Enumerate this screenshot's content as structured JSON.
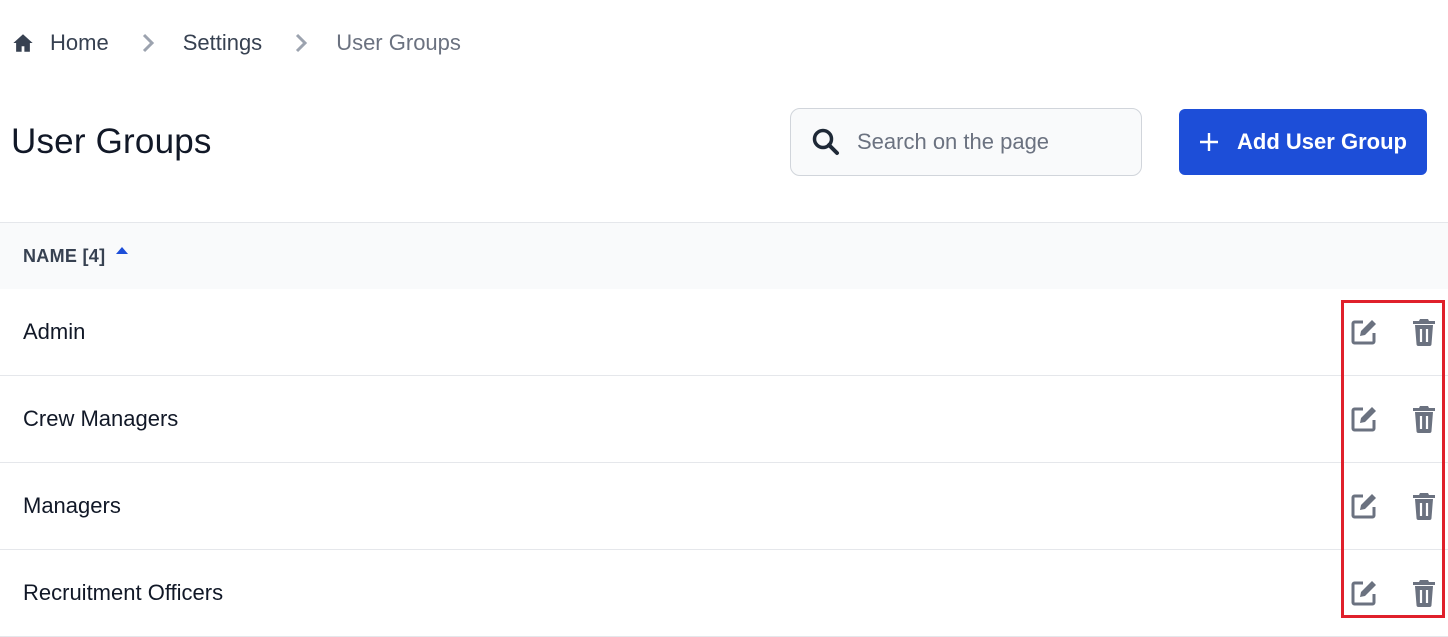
{
  "breadcrumb": {
    "items": [
      {
        "label": "Home",
        "icon": "home-icon"
      },
      {
        "label": "Settings"
      },
      {
        "label": "User Groups"
      }
    ],
    "separator_icon": "chevron-right-icon"
  },
  "header": {
    "title": "User Groups",
    "search": {
      "placeholder": "Search on the page",
      "value": "",
      "icon": "search-icon"
    },
    "add_button": {
      "label": "Add User Group",
      "icon": "plus-icon"
    }
  },
  "table": {
    "columns": [
      {
        "label": "NAME [4]",
        "sort": "ascending",
        "sort_icon": "sort-asc-icon"
      }
    ],
    "rows": [
      {
        "name": "Admin",
        "actions": [
          "edit-icon",
          "trash-icon"
        ]
      },
      {
        "name": "Crew Managers",
        "actions": [
          "edit-icon",
          "trash-icon"
        ]
      },
      {
        "name": "Managers",
        "actions": [
          "edit-icon",
          "trash-icon"
        ]
      },
      {
        "name": "Recruitment Officers",
        "actions": [
          "edit-icon",
          "trash-icon"
        ]
      }
    ]
  },
  "annotation": {
    "highlight_color": "#e0202b",
    "target": "row-actions"
  },
  "colors": {
    "primary": "#1d4ed8",
    "text": "#111827",
    "muted": "#6b7280",
    "icon": "#6b7280",
    "header_bg": "#f9fafb"
  }
}
